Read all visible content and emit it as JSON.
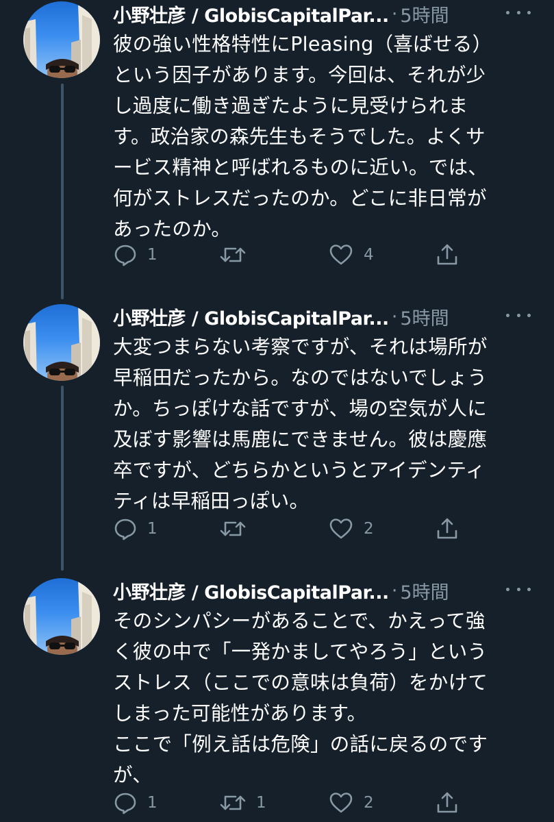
{
  "colors": {
    "background": "#15202b",
    "text_primary": "#ffffff",
    "text_secondary": "#8899a6",
    "thread_line": "#3d5466"
  },
  "tweets": [
    {
      "author": "小野壮彦 / GlobisCapitalPar...",
      "separator": "·",
      "time": "5時間",
      "lines": [
        "彼の強い性格特性にPleasing（喜ばせる）",
        "という因子があります。今回は、それが少",
        "し過度に働き過ぎたように見受けられま",
        "す。政治家の森先生もそうでした。よくサ",
        "ービス精神と呼ばれるものに近い。では、",
        "何がストレスだったのか。どこに非日常が",
        "あったのか。"
      ],
      "reply_count": "1",
      "retweet_count": "",
      "like_count": "4"
    },
    {
      "author": "小野壮彦 / GlobisCapitalPar...",
      "separator": "·",
      "time": "5時間",
      "lines": [
        "大変つまらない考察ですが、それは場所が",
        "早稲田だったから。なのではないでしょう",
        "か。ちっぽけな話ですが、場の空気が人に",
        "及ぼす影響は馬鹿にできません。彼は慶應",
        "卒ですが、どちらかというとアイデンティ",
        "ティは早稲田っぽい。"
      ],
      "reply_count": "1",
      "retweet_count": "",
      "like_count": "2"
    },
    {
      "author": "小野壮彦 / GlobisCapitalPar...",
      "separator": "·",
      "time": "5時間",
      "lines": [
        "そのシンパシーがあることで、かえって強",
        "く彼の中で「一発かましてやろう」という",
        "ストレス（ここでの意味は負荷）をかけて",
        "しまった可能性があります。",
        "ここで「例え話は危険」の話に戻るのです",
        "が、"
      ],
      "reply_count": "1",
      "retweet_count": "1",
      "like_count": "2"
    }
  ]
}
